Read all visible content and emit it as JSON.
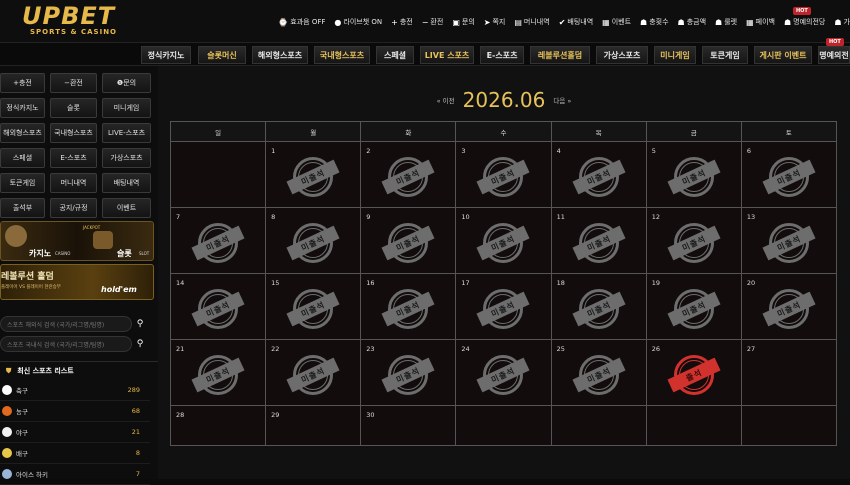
{
  "logo": {
    "main": "UPBET",
    "sub": "SPORTS & CASINO"
  },
  "topnav": [
    {
      "icon": "clock-icon",
      "glyph": "⌚",
      "label": "효과음 OFF"
    },
    {
      "icon": "chat-icon",
      "glyph": "●",
      "label": "라이브챗 ON"
    },
    {
      "icon": "plus-icon",
      "glyph": "+",
      "label": "충전"
    },
    {
      "icon": "minus-icon",
      "glyph": "−",
      "label": "환전"
    },
    {
      "icon": "question-icon",
      "glyph": "▣",
      "label": "문의"
    },
    {
      "icon": "send-icon",
      "glyph": "➤",
      "label": "쪽지"
    },
    {
      "icon": "list-icon",
      "glyph": "▤",
      "label": "머니내역"
    },
    {
      "icon": "check-icon",
      "glyph": "✔",
      "label": "배팅내역"
    },
    {
      "icon": "calendar-icon",
      "glyph": "▦",
      "label": "이벤트"
    },
    {
      "icon": "gift-icon",
      "glyph": "☗",
      "label": "충횟수"
    },
    {
      "icon": "coin-icon",
      "glyph": "☗",
      "label": "충금액"
    },
    {
      "icon": "roulette-icon",
      "glyph": "☗",
      "label": "룰렛"
    },
    {
      "icon": "coin-stack-icon",
      "glyph": "▦",
      "label": "페이백"
    },
    {
      "icon": "trophy-icon",
      "glyph": "☗",
      "label": "명예의전당"
    },
    {
      "icon": "user-icon",
      "glyph": "☗",
      "label": "가"
    }
  ],
  "hot_label": "HOT",
  "gnav": [
    {
      "label": "정식카지노",
      "gold": false
    },
    {
      "label": "슬롯머신",
      "gold": true
    },
    {
      "label": "해외형스포츠",
      "gold": false
    },
    {
      "label": "국내형스포츠",
      "gold": true
    },
    {
      "label": "스페셜",
      "gold": false
    },
    {
      "label": "LIVE 스포츠",
      "gold": true
    },
    {
      "label": "E-스포츠",
      "gold": false
    },
    {
      "label": "레볼루션홀덤",
      "gold": true
    },
    {
      "label": "가상스포츠",
      "gold": false
    },
    {
      "label": "미니게임",
      "gold": true
    },
    {
      "label": "토큰게임",
      "gold": false
    },
    {
      "label": "게시판 이벤트",
      "gold": true
    },
    {
      "label": "명예의전",
      "gold": false
    }
  ],
  "sidebar": {
    "buttons": [
      "+충전",
      "−환전",
      "❶문의",
      "정식카지노",
      "슬롯",
      "미니게임",
      "해외형스포츠",
      "국내형스포츠",
      "LIVE-스포츠",
      "스페셜",
      "E-스포츠",
      "가상스포츠",
      "토큰게임",
      "머니내역",
      "배팅내역",
      "출석부",
      "공지/규정",
      "이벤트"
    ],
    "banner1": {
      "casino": "카지노",
      "casino_sub": "CASINO",
      "slot": "슬롯",
      "slot_sub": "SLOT",
      "jackpot": "JACKPOT"
    },
    "banner2": {
      "title": "레볼루션 홀덤",
      "sub": "플레이어 VS 플레이어 현란승부",
      "logo": "hold'em"
    },
    "search1": "스포츠 해외식 검색 (국가/리그명/팀명)",
    "search2": "스포츠 국내식 검색 (국가/리그명/팀명)",
    "list_title": "최신 스포츠 리스트",
    "sports": [
      {
        "name": "축구",
        "count": "289",
        "color": "#ffffff"
      },
      {
        "name": "농구",
        "count": "68",
        "color": "#e06a1f"
      },
      {
        "name": "야구",
        "count": "21",
        "color": "#f2f2f2"
      },
      {
        "name": "배구",
        "count": "8",
        "color": "#e8c84a"
      },
      {
        "name": "아이스 하키",
        "count": "7",
        "color": "#9ab7d8"
      }
    ]
  },
  "calendar": {
    "prev": "« 이전",
    "month": "2026.06",
    "next": "다음 »",
    "weekdays": [
      "일",
      "월",
      "화",
      "수",
      "목",
      "금",
      "토"
    ],
    "absent_label": "미출석",
    "present_label": "출석",
    "weeks": [
      [
        {
          "d": "",
          "s": ""
        },
        {
          "d": "1",
          "s": "absent"
        },
        {
          "d": "2",
          "s": "absent"
        },
        {
          "d": "3",
          "s": "absent"
        },
        {
          "d": "4",
          "s": "absent"
        },
        {
          "d": "5",
          "s": "absent"
        },
        {
          "d": "6",
          "s": "absent"
        }
      ],
      [
        {
          "d": "7",
          "s": "absent"
        },
        {
          "d": "8",
          "s": "absent"
        },
        {
          "d": "9",
          "s": "absent"
        },
        {
          "d": "10",
          "s": "absent"
        },
        {
          "d": "11",
          "s": "absent"
        },
        {
          "d": "12",
          "s": "absent"
        },
        {
          "d": "13",
          "s": "absent"
        }
      ],
      [
        {
          "d": "14",
          "s": "absent"
        },
        {
          "d": "15",
          "s": "absent"
        },
        {
          "d": "16",
          "s": "absent"
        },
        {
          "d": "17",
          "s": "absent"
        },
        {
          "d": "18",
          "s": "absent"
        },
        {
          "d": "19",
          "s": "absent"
        },
        {
          "d": "20",
          "s": "absent"
        }
      ],
      [
        {
          "d": "21",
          "s": "absent"
        },
        {
          "d": "22",
          "s": "absent"
        },
        {
          "d": "23",
          "s": "absent"
        },
        {
          "d": "24",
          "s": "absent"
        },
        {
          "d": "25",
          "s": "absent"
        },
        {
          "d": "26",
          "s": "present"
        },
        {
          "d": "27",
          "s": ""
        }
      ],
      [
        {
          "d": "28",
          "s": ""
        },
        {
          "d": "29",
          "s": ""
        },
        {
          "d": "30",
          "s": ""
        },
        {
          "d": "",
          "s": ""
        },
        {
          "d": "",
          "s": ""
        },
        {
          "d": "",
          "s": ""
        },
        {
          "d": "",
          "s": ""
        }
      ]
    ]
  },
  "colors": {
    "gold": "#e7c25a",
    "stamp_absent": "#6d6d6d",
    "stamp_present": "#d2322e"
  }
}
